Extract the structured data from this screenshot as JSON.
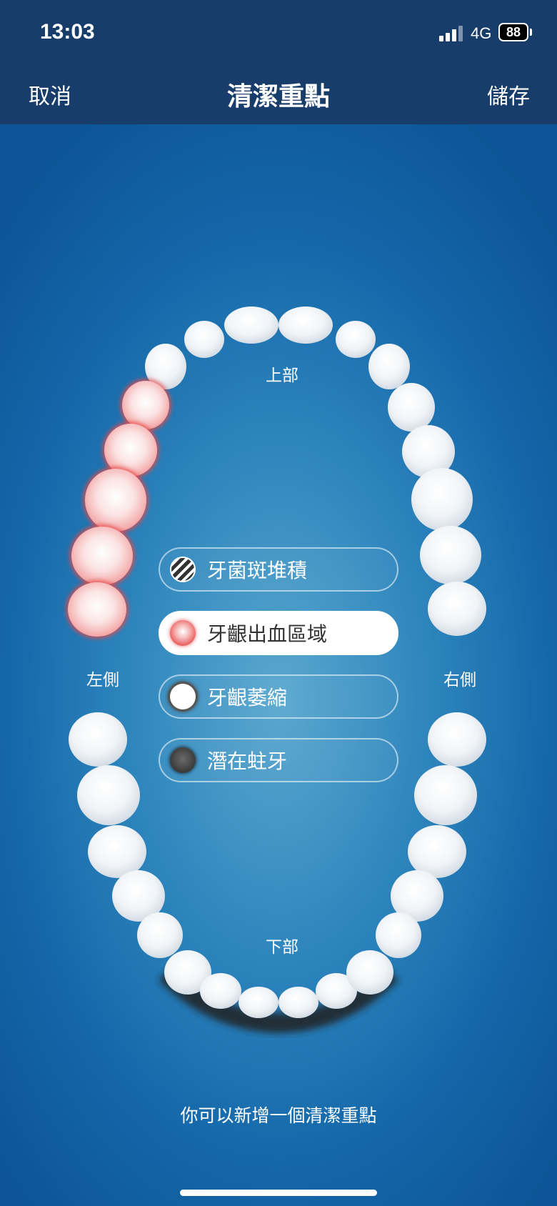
{
  "status_bar": {
    "time": "13:03",
    "network": "4G",
    "battery": "88"
  },
  "nav": {
    "cancel": "取消",
    "title": "清潔重點",
    "save": "儲存"
  },
  "jaw_labels": {
    "upper": "上部",
    "lower": "下部",
    "left": "左側",
    "right": "右側"
  },
  "legend": [
    {
      "label": "牙菌斑堆積",
      "icon": "hatched-circle-icon",
      "selected": false
    },
    {
      "label": "牙齦出血區域",
      "icon": "red-circle-icon",
      "selected": true
    },
    {
      "label": "牙齦萎縮",
      "icon": "white-circle-icon",
      "selected": false
    },
    {
      "label": "潛在蛀牙",
      "icon": "dark-circle-icon",
      "selected": false
    }
  ],
  "hint": "你可以新增一個清潔重點",
  "colors": {
    "nav_background": "#183d6a",
    "bleeding_highlight": "#e84a4a",
    "decay_highlight": "#333333",
    "background": "#1a6aab"
  }
}
